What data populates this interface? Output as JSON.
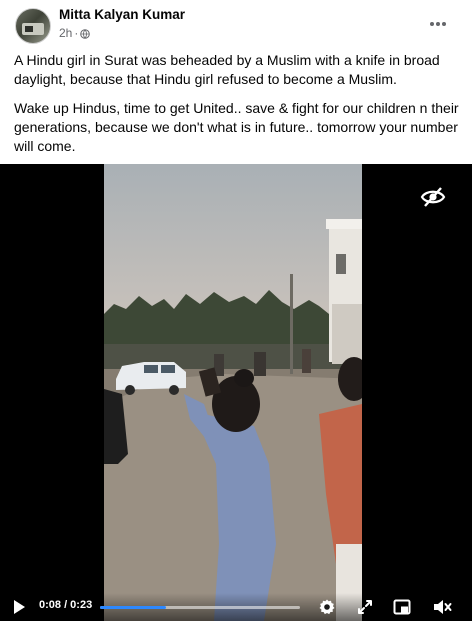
{
  "post": {
    "author": "Mitta Kalyan Kumar",
    "time": "2h",
    "separator": "·",
    "paragraphs": [
      "A Hindu girl in Surat was beheaded by a Muslim with a knife in broad daylight, because that Hindu girl refused to become a Muslim.",
      "Wake up Hindus, time to get United.. save & fight for our children n their generations, because we don't what is in future.. tomorrow your number will come."
    ]
  },
  "video": {
    "time_display": "0:08 / 0:23",
    "progress": 0.33,
    "icons": {
      "play": "play-icon",
      "settings": "gear-icon",
      "fullscreen": "expand-icon",
      "pip": "picture-in-picture-icon",
      "mute": "volume-muted-icon",
      "visibility": "eye-off-icon"
    },
    "accent": "#2d88ff"
  },
  "colors": {
    "text": "#050505",
    "secondary": "#65676b",
    "video_bg": "#000000"
  }
}
